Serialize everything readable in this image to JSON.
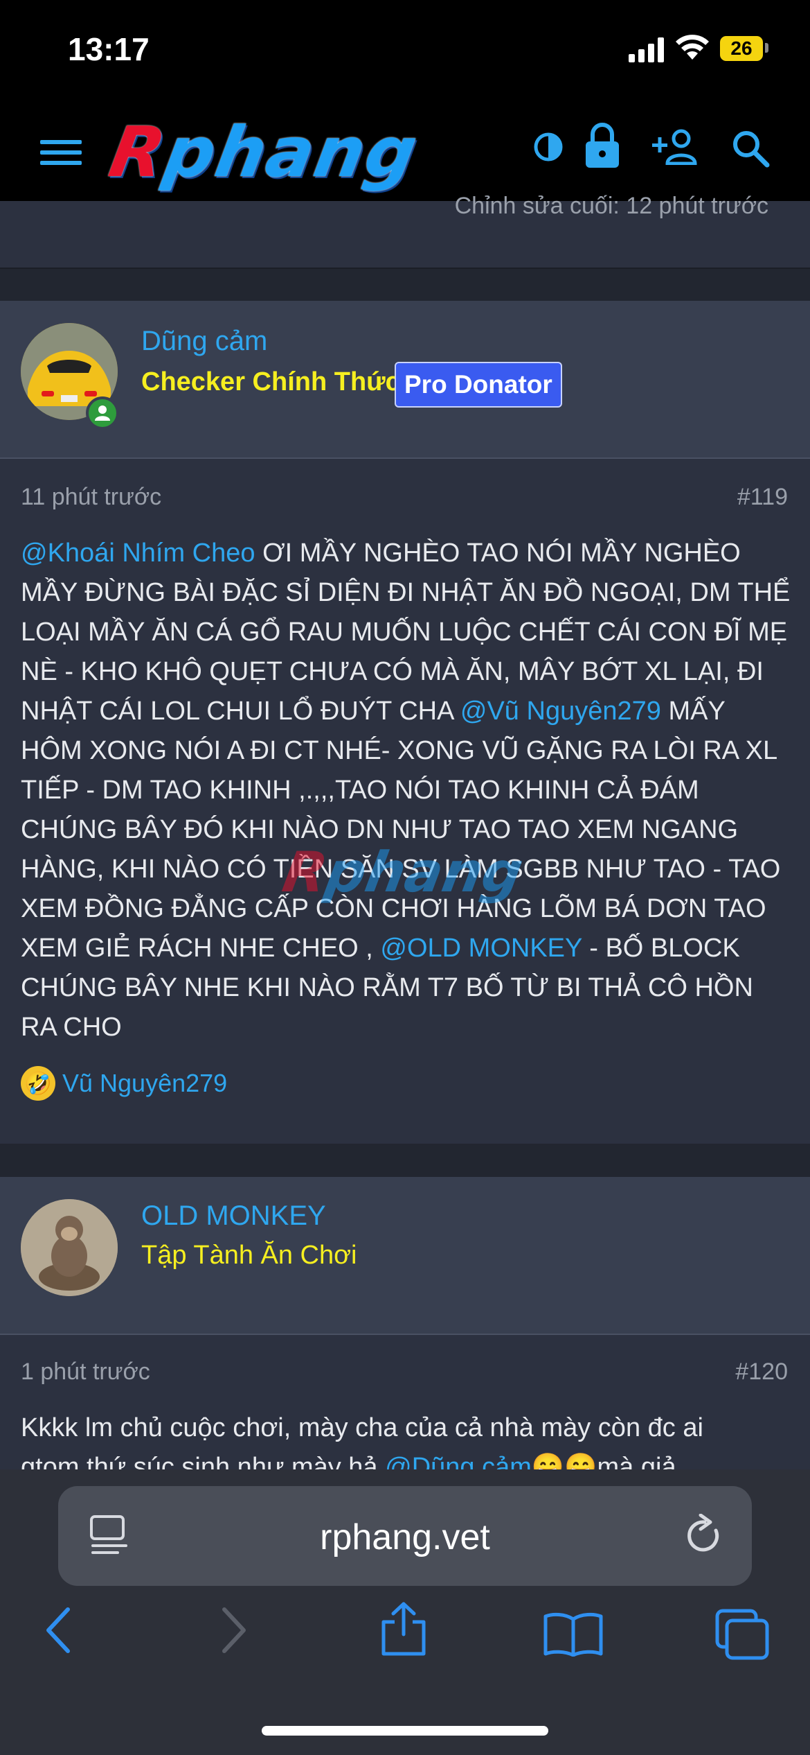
{
  "status": {
    "time": "13:17",
    "battery": "26"
  },
  "header": {
    "logo_r": "R",
    "logo_rest": "phang",
    "icons": [
      "menu-icon",
      "contrast-icon",
      "lock-icon",
      "add-user-icon",
      "search-icon"
    ]
  },
  "prev_post": {
    "edited": "Chỉnh sửa cuối: 12 phút trước"
  },
  "posts": [
    {
      "user": "Dũng cảm",
      "title": "Checker Chính Thức",
      "badge": "Pro Donator",
      "time": "11 phút trước",
      "number": "#119",
      "mention1": "@Khoái Nhím Cheo",
      "text1": " ƠI MẦY NGHÈO TAO NÓI MẦY NGHÈO MẦY ĐỪNG BÀI ĐẶC SỈ DIỆN ĐI NHẬT ĂN ĐỒ NGOẠI, DM THỂ LOẠI MẦY ĂN CÁ GỔ RAU MUỐN LUỘC CHẾT CÁI CON ĐĨ MẸ NÈ - KHO KHÔ QUẸT CHƯA CÓ MÀ ĂN, MÂY BỚT XL LẠI, ĐI NHẬT CÁI LOL CHUI LỔ ĐUÝT CHA ",
      "mention2": "@Vũ Nguyên279",
      "text2": " MẤY HÔM XONG NÓI A ĐI CT NHÉ- XONG VŨ GẶNG RA LÒI RA XL TIẾP - DM TAO KHINH ,.,,,TAO NÓI TAO KHINH CẢ ĐÁM CHÚNG BÂY ĐÓ KHI NÀO DN NHƯ TAO TAO XEM NGANG HÀNG, KHI NÀO CÓ TIỀN SĂN SV LÀM SGBB NHƯ TAO - TAO XEM ĐỒNG ĐẲNG CẤP CÒN CHƠI HÀNG LÕM BÁ DƠN TAO XEM GIẺ RÁCH NHE CHEO , ",
      "mention3": "@OLD MONKEY",
      "text3": " - BỐ BLOCK CHÚNG BÂY NHE KHI NÀO RẰM T7 BỐ TỪ BI THẢ CÔ HỒN RA CHO",
      "reaction_user": "Vũ Nguyên279"
    },
    {
      "user": "OLD MONKEY",
      "title": "Tập Tành Ăn Chơi",
      "time": "1 phút trước",
      "number": "#120",
      "text1": "Kkkk lm chủ cuộc chơi, mày cha của cả nhà mày còn đc ai",
      "text2": "gtom thứ súc sinh như mày hả ",
      "mention1": "@Dũng cảm",
      "text3": "😁😁mà giả"
    }
  ],
  "browser": {
    "url": "rphang.vet"
  }
}
